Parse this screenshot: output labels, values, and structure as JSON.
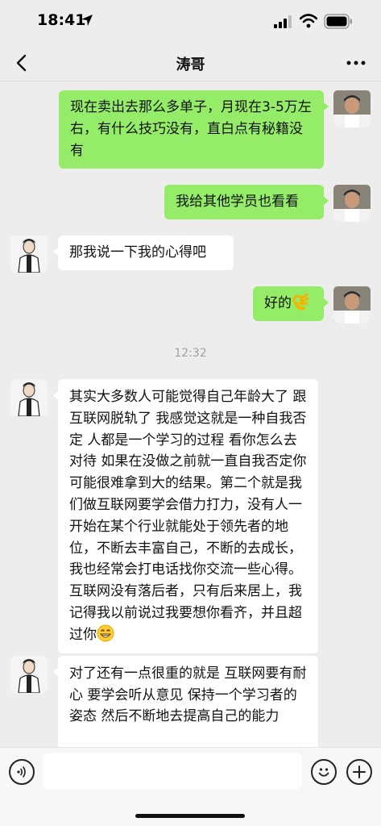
{
  "status_bar": {
    "time": "18:41",
    "icons": [
      "location-arrow-icon",
      "signal-icon",
      "wifi-icon",
      "battery-icon"
    ]
  },
  "nav": {
    "title": "涛哥",
    "back_icon": "chevron-left-icon",
    "more_icon": "more-icon"
  },
  "messages": [
    {
      "sender": "me",
      "text": "现在卖出去那么多单子，月现在3-5万左右，有什么技巧没有，直白点有秘籍没有"
    },
    {
      "sender": "me",
      "text": "我给其他学员也看看"
    },
    {
      "sender": "other",
      "text": "那我说一下我的心得吧"
    },
    {
      "sender": "me",
      "text": "好的",
      "emoji": "ok-hand-emoji"
    },
    {
      "sender": "other",
      "text": "其实大多数人可能觉得自己年龄大了 跟互联网脱轨了 我感觉这就是一种自我否定 人都是一个学习的过程 看你怎么去对待 如果在没做之前就一直自我否定你可能很难拿到大的结果。第二个就是我们做互联网要学会借力打力，没有人一开始在某个行业就能处于领先者的地位，不断去丰富自己，不断的去成长，我也经常会打电话找你交流一些心得。 互联网没有落后者，只有后来居上，我记得我以前说过我要想你看齐，并且超过你",
      "emoji": "grin-emoji"
    },
    {
      "sender": "other",
      "text": "对了还有一点很重的就是 互联网要有耐心 要学会听从意见 保持一个学习者的姿态 然后不断地去提高自己的能力"
    }
  ],
  "timestamp": "12:32",
  "input_bar": {
    "voice_icon": "voice-icon",
    "emoji_icon": "emoji-icon",
    "plus_icon": "plus-icon",
    "placeholder": ""
  },
  "colors": {
    "background": "#ededed",
    "my_bubble": "#95ec69",
    "other_bubble": "#ffffff"
  }
}
